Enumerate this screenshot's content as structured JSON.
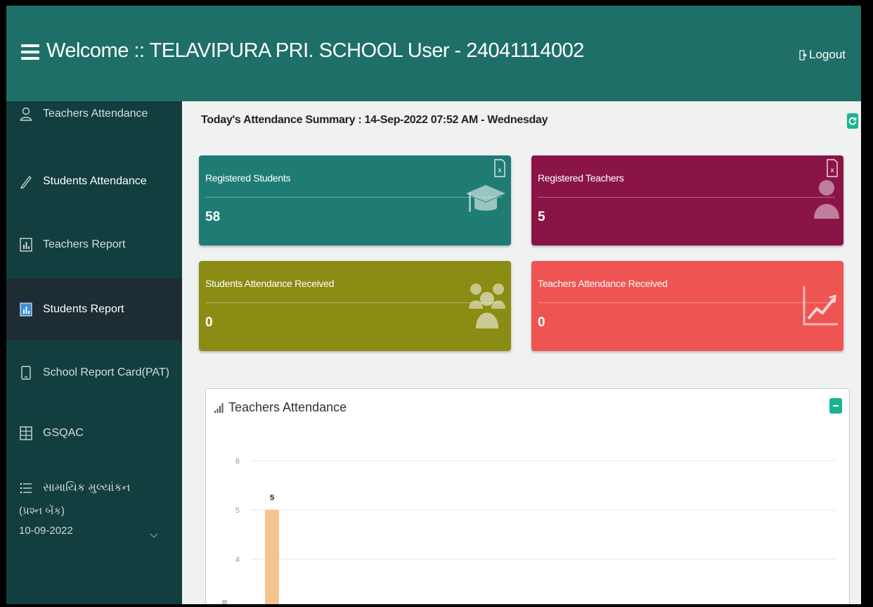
{
  "header": {
    "title": "Welcome :: TELAVIPURA PRI. SCHOOL User - 24041114002",
    "logout_label": "Logout"
  },
  "sidebar": {
    "items": [
      {
        "label": "Teachers Attendance",
        "icon": "person-icon"
      },
      {
        "label": "Students Attendance",
        "icon": "pencil-icon"
      },
      {
        "label": "Teachers Report",
        "icon": "report-icon"
      },
      {
        "label": "Students Report",
        "icon": "report-icon",
        "active": true
      },
      {
        "label": "School Report Card(PAT)",
        "icon": "tablet-icon"
      },
      {
        "label": "GSQAC",
        "icon": "grid-icon"
      },
      {
        "label": "સામાયિક મુલ્યાંકન",
        "icon": "list-icon"
      }
    ],
    "sub_label": "(પ્રશ્ન બેંક)",
    "date_value": "10-09-2022"
  },
  "summary": {
    "text": "Today's Attendance Summary : 14-Sep-2022 07:52 AM - Wednesday"
  },
  "cards": [
    {
      "label": "Registered Students",
      "value": "58",
      "color": "#1f7c74",
      "icon": "graduation-cap-icon"
    },
    {
      "label": "Registered Teachers",
      "value": "5",
      "color": "#8b1446",
      "icon": "user-icon"
    },
    {
      "label": "Students Attendance Received",
      "value": "0",
      "color": "#8b8c13",
      "icon": "users-group-icon"
    },
    {
      "label": "Teachers Attendance Received",
      "value": "0",
      "color": "#ee5451",
      "icon": "line-chart-icon"
    }
  ],
  "panel": {
    "title": "Teachers Attendance"
  },
  "chart_data": {
    "type": "bar",
    "title": "Teachers Attendance",
    "ylim": [
      0,
      6
    ],
    "y_ticks": [
      "6",
      "5",
      "4"
    ],
    "series": [
      {
        "values": [
          5
        ]
      }
    ],
    "data_labels": [
      "5"
    ],
    "bar_color": "#f5c48e",
    "grid": true
  }
}
